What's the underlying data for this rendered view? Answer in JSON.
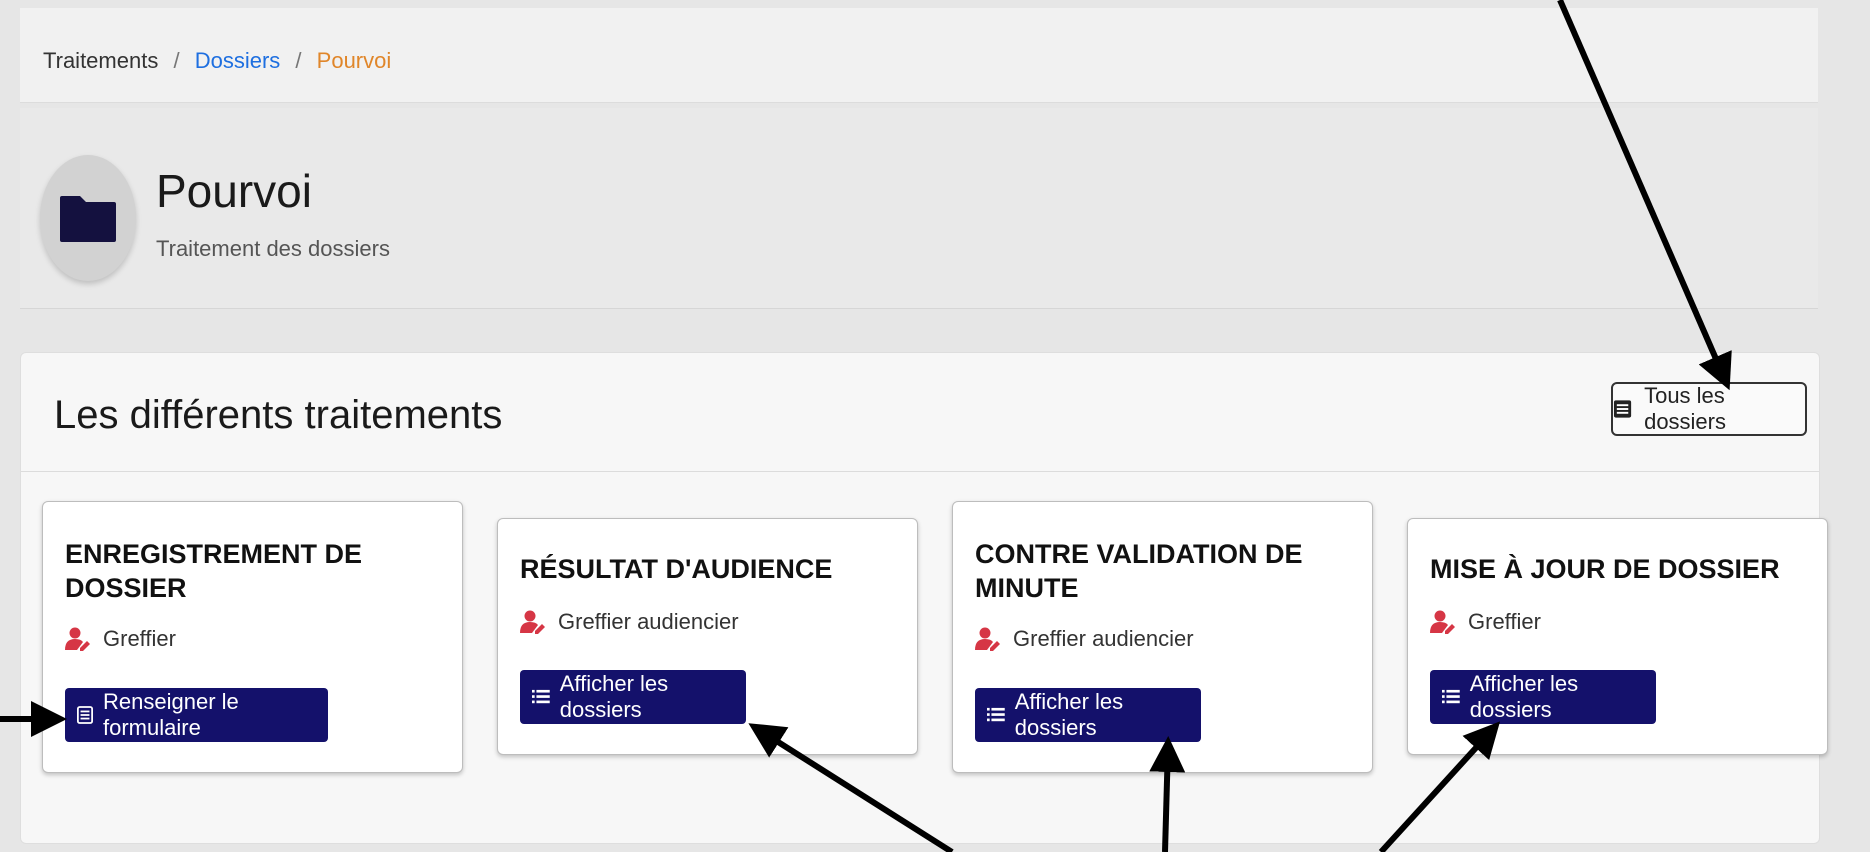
{
  "breadcrumb": {
    "item1": "Traitements",
    "item2": "Dossiers",
    "item3": "Pourvoi",
    "separator": "/"
  },
  "header": {
    "title": "Pourvoi",
    "subtitle": "Traitement des dossiers",
    "icon": "folder-icon"
  },
  "section": {
    "title": "Les différents traitements",
    "all_files_label": "Tous les dossiers"
  },
  "cards": [
    {
      "title": "ENREGISTREMENT DE DOSSIER",
      "role": "Greffier",
      "button": "Renseigner le formulaire"
    },
    {
      "title": "RÉSULTAT D'AUDIENCE",
      "role": "Greffier audiencier",
      "button": "Afficher les dossiers"
    },
    {
      "title": "CONTRE VALIDATION DE MINUTE",
      "role": "Greffier audiencier",
      "button": "Afficher les dossiers"
    },
    {
      "title": "MISE À JOUR DE DOSSIER",
      "role": "Greffier",
      "button": "Afficher les dossiers"
    }
  ],
  "colors": {
    "primary_button": "#14116b",
    "breadcrumb_link": "#1e6fe0",
    "breadcrumb_active": "#e0862a",
    "role_icon": "#d63645"
  }
}
